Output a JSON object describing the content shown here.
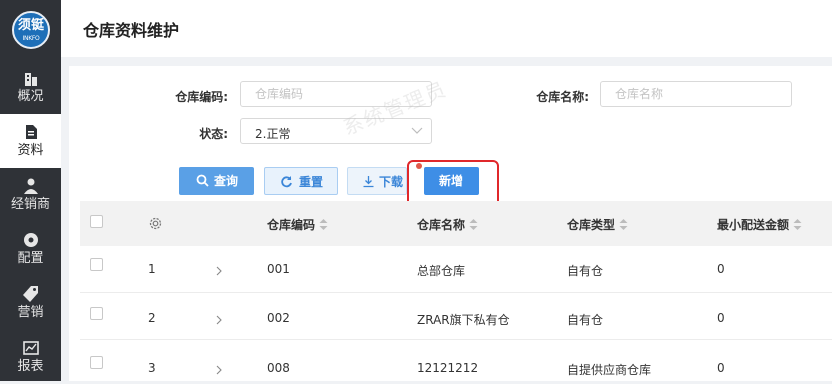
{
  "logo": {
    "line1": "须铤",
    "line2": "INKFO"
  },
  "sidebar": {
    "items": [
      {
        "label": "概况",
        "icon": "building-icon",
        "active": false
      },
      {
        "label": "资料",
        "icon": "document-icon",
        "active": true
      },
      {
        "label": "经销商",
        "icon": "dealer-icon",
        "active": false
      },
      {
        "label": "配置",
        "icon": "settings-icon",
        "active": false
      },
      {
        "label": "营销",
        "icon": "tag-icon",
        "active": false
      },
      {
        "label": "报表",
        "icon": "report-icon",
        "active": false
      }
    ]
  },
  "header": {
    "title": "仓库资料维护"
  },
  "filters": {
    "code_label": "仓库编码:",
    "code_placeholder": "仓库编码",
    "name_label": "仓库名称:",
    "name_placeholder": "仓库名称",
    "status_label": "状态:",
    "status_value": "2.正常"
  },
  "toolbar": {
    "query_label": "查询",
    "reset_label": "重置",
    "download_label": "下载",
    "add_label": "新增"
  },
  "table": {
    "columns": [
      "仓库编码",
      "仓库名称",
      "仓库类型",
      "最小配送金额"
    ],
    "rows": [
      {
        "index": "1",
        "code": "001",
        "name": "总部仓库",
        "type": "自有仓",
        "min_amount": "0"
      },
      {
        "index": "2",
        "code": "002",
        "name": "ZRAR旗下私有仓",
        "type": "自有仓",
        "min_amount": "0"
      },
      {
        "index": "3",
        "code": "008",
        "name": "12121212",
        "type": "自提供应商仓库",
        "min_amount": "0"
      }
    ]
  },
  "watermark": "系统管理员",
  "colors": {
    "sidebar_bg": "#2f3237",
    "primary": "#3e8ee6",
    "highlight": "#e0282b"
  }
}
